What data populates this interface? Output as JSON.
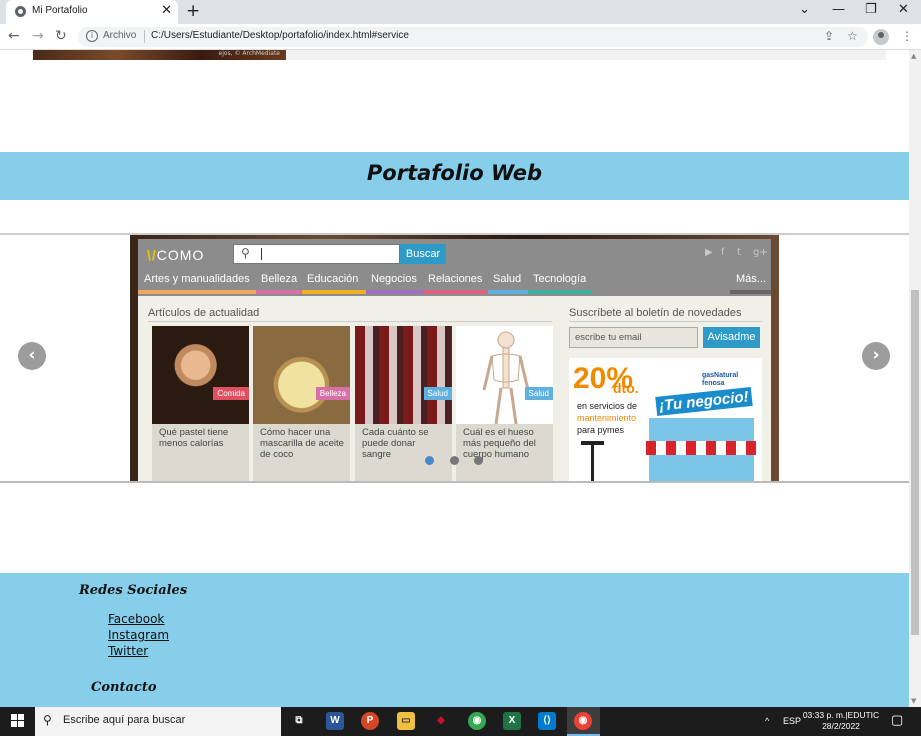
{
  "browser": {
    "tab_title": "Mi Portafolio",
    "tab_close": "✕",
    "new_tab": "+",
    "window_controls": {
      "dropdown": "⌄",
      "minimize": "—",
      "restore": "❐",
      "close": "✕"
    },
    "nav": {
      "back": "←",
      "forward": "→",
      "reload": "↻"
    },
    "security_label": "Archivo",
    "url": "C:/Users/Estudiante/Desktop/portafolio/index.html#service",
    "share_icon": "⇪",
    "bookmark_icon": "☆",
    "menu_icon": "⋮"
  },
  "page": {
    "top_image_caption": "ejos, © ArchMediate",
    "section_title": "Portafolio Web",
    "carousel": {
      "prev": "‹",
      "next": "›",
      "slide": {
        "logo_prefix": "\\/",
        "logo_text": "COMO",
        "search_icon": "⚲",
        "search_button": "Buscar",
        "social_icons": [
          "▶",
          "f",
          "t",
          "g+"
        ],
        "categories": [
          {
            "label": "Artes y manualidades",
            "color": "#f0a860"
          },
          {
            "label": "Belleza",
            "color": "#d870a8"
          },
          {
            "label": "Educación",
            "color": "#f0b020"
          },
          {
            "label": "Negocios",
            "color": "#a070c0"
          },
          {
            "label": "Relaciones",
            "color": "#e06080"
          },
          {
            "label": "Salud",
            "color": "#60b0e0"
          },
          {
            "label": "Tecnología",
            "color": "#40b0a0"
          },
          {
            "label": "Más...",
            "color": "#666666"
          }
        ],
        "articles_heading": "Artículos de actualidad",
        "articles": [
          {
            "tag": "Comida",
            "tag_color": "#e05060",
            "text": "Qué pastel tiene menos calorías"
          },
          {
            "tag": "Belleza",
            "tag_color": "#d870a8",
            "text": "Cómo hacer una mascarilla de aceite de coco"
          },
          {
            "tag": "Salud",
            "tag_color": "#60b0e0",
            "text": "Cada cuánto se puede donar sangre"
          },
          {
            "tag": "Salud",
            "tag_color": "#60b0e0",
            "text": "Cuál es el hueso más pequeño del cuerpo humano"
          }
        ],
        "newsletter_heading": "Suscríbete al boletín de novedades",
        "newsletter_placeholder": "escribe tu email",
        "newsletter_button": "Avisadme",
        "ad": {
          "percent": "20%",
          "dto": "dto.",
          "line1": "en servicios de",
          "line2": "mantenimiento",
          "line3": "para pymes",
          "brand": "gasNatural fenosa",
          "headline": "¡Tu negocio!"
        }
      }
    },
    "footer": {
      "social_heading": "Redes Sociales",
      "links": [
        "Facebook",
        "Instagram",
        "Twitter"
      ],
      "contact_heading": "Contacto"
    }
  },
  "taskbar": {
    "search_placeholder": "Escribe aquí para buscar",
    "apps": [
      {
        "name": "task-view",
        "glyph": "⧉",
        "color": "#1c1c1c"
      },
      {
        "name": "word",
        "glyph": "W",
        "color": "#2b579a"
      },
      {
        "name": "powerpoint",
        "glyph": "P",
        "color": "#d24726"
      },
      {
        "name": "file-explorer",
        "glyph": "▭",
        "color": "#f0c040"
      },
      {
        "name": "red-app",
        "glyph": "◆",
        "color": "#c8102e"
      },
      {
        "name": "chrome",
        "glyph": "◉",
        "color": "#34a853"
      },
      {
        "name": "excel",
        "glyph": "X",
        "color": "#217346"
      },
      {
        "name": "vscode",
        "glyph": "⟨⟩",
        "color": "#007acc"
      },
      {
        "name": "chrome-active",
        "glyph": "◉",
        "color": "#ea4335"
      }
    ],
    "tray_chevron": "^",
    "language": "ESP",
    "clock_time": "03:33 p. m.|EDUTIC",
    "clock_date": "28/2/2022",
    "notification_icon": "▢"
  }
}
